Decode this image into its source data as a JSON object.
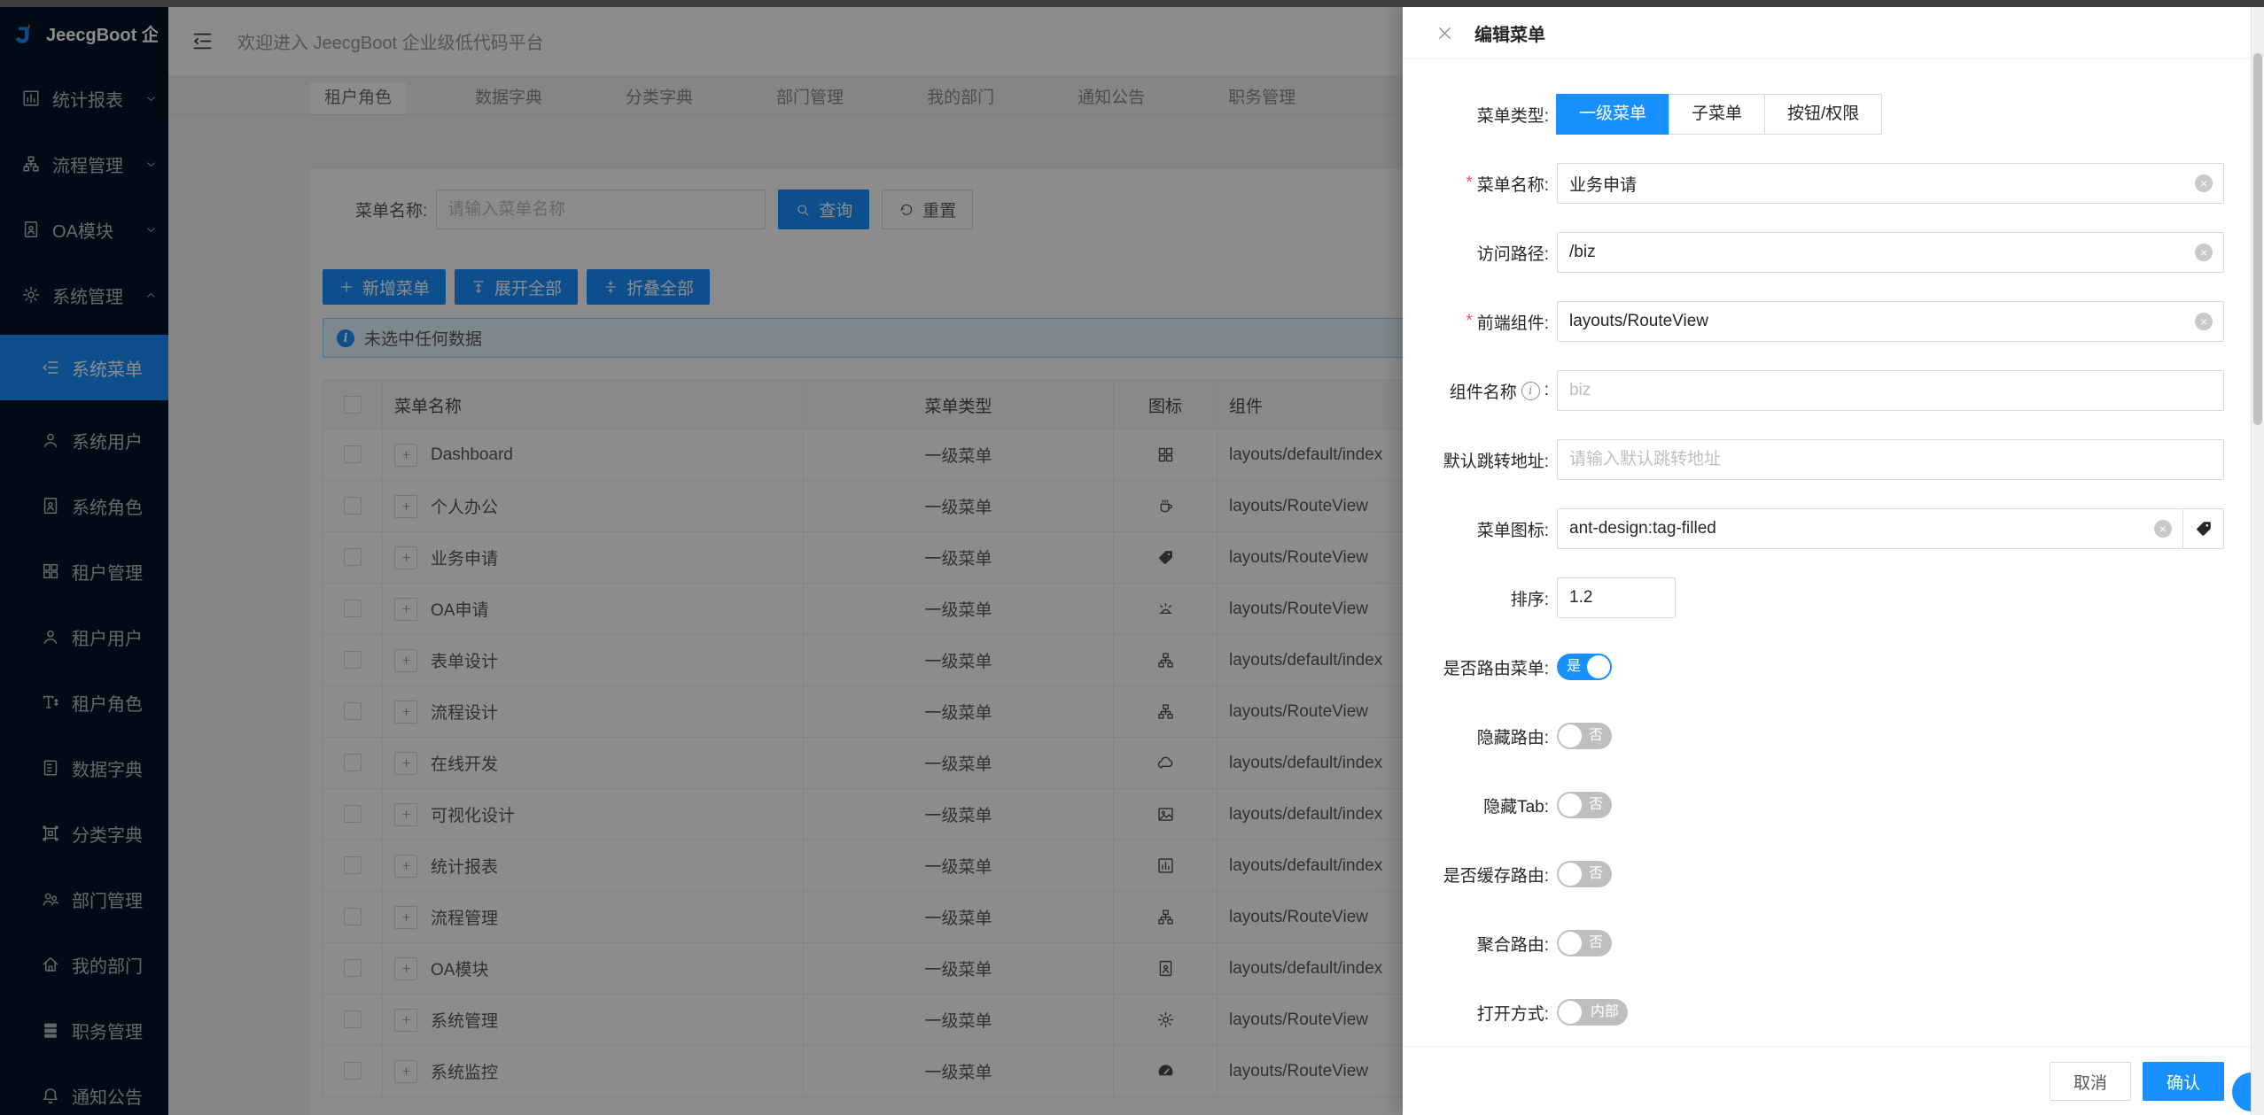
{
  "colors": {
    "accent": "#1890ff",
    "sidebar_bg": "#001529",
    "alert_bg": "#e6f7ff",
    "alert_border": "#91d5ff",
    "required": "#ff4d4f"
  },
  "sidebar": {
    "logo_text": "JeecgBoot 企业级...",
    "top_items": [
      {
        "icon": "bar-chart",
        "label": "统计报表",
        "chevron": "chevron-down"
      },
      {
        "icon": "cluster",
        "label": "流程管理",
        "chevron": "chevron-down"
      },
      {
        "icon": "file-user",
        "label": "OA模块",
        "chevron": "chevron-down"
      },
      {
        "icon": "gear",
        "label": "系统管理",
        "chevron": "chevron-up"
      }
    ],
    "submenu": [
      {
        "icon": "menu",
        "label": "系统菜单",
        "active": true
      },
      {
        "icon": "user",
        "label": "系统用户"
      },
      {
        "icon": "file-user",
        "label": "系统角色"
      },
      {
        "icon": "grid",
        "label": "租户管理"
      },
      {
        "icon": "user",
        "label": "租户用户"
      },
      {
        "icon": "font-size",
        "label": "租户角色"
      },
      {
        "icon": "database",
        "label": "数据字典"
      },
      {
        "icon": "box",
        "label": "分类字典"
      },
      {
        "icon": "team",
        "label": "部门管理"
      },
      {
        "icon": "home",
        "label": "我的部门"
      },
      {
        "icon": "stack",
        "label": "职务管理"
      },
      {
        "icon": "bell",
        "label": "通知公告"
      }
    ]
  },
  "header": {
    "welcome": "欢迎进入 JeecgBoot 企业级低代码平台"
  },
  "tabs": [
    {
      "label": "租户角色",
      "active": true
    },
    {
      "label": "数据字典"
    },
    {
      "label": "分类字典"
    },
    {
      "label": "部门管理"
    },
    {
      "label": "我的部门"
    },
    {
      "label": "通知公告"
    },
    {
      "label": "职务管理"
    }
  ],
  "search": {
    "label": "菜单名称:",
    "placeholder": "请输入菜单名称",
    "query": "查询",
    "reset": "重置"
  },
  "toolbar": {
    "add": "新增菜单",
    "expand": "展开全部",
    "collapse": "折叠全部"
  },
  "alert": {
    "text": "未选中任何数据"
  },
  "table": {
    "columns": [
      "菜单名称",
      "菜单类型",
      "图标",
      "组件"
    ],
    "rows": [
      {
        "name": "Dashboard",
        "type": "一级菜单",
        "icon": "grid",
        "component": "layouts/default/index"
      },
      {
        "name": "个人办公",
        "type": "一级菜单",
        "icon": "coffee",
        "component": "layouts/RouteView"
      },
      {
        "name": "业务申请",
        "type": "一级菜单",
        "icon": "tag-filled",
        "component": "layouts/RouteView"
      },
      {
        "name": "OA申请",
        "type": "一级菜单",
        "icon": "siren",
        "component": "layouts/RouteView"
      },
      {
        "name": "表单设计",
        "type": "一级菜单",
        "icon": "cluster",
        "component": "layouts/default/index"
      },
      {
        "name": "流程设计",
        "type": "一级菜单",
        "icon": "cluster",
        "component": "layouts/RouteView"
      },
      {
        "name": "在线开发",
        "type": "一级菜单",
        "icon": "cloud",
        "component": "layouts/default/index"
      },
      {
        "name": "可视化设计",
        "type": "一级菜单",
        "icon": "picture",
        "component": "layouts/default/index"
      },
      {
        "name": "统计报表",
        "type": "一级菜单",
        "icon": "bar-chart",
        "component": "layouts/default/index"
      },
      {
        "name": "流程管理",
        "type": "一级菜单",
        "icon": "cluster",
        "component": "layouts/RouteView"
      },
      {
        "name": "OA模块",
        "type": "一级菜单",
        "icon": "file-user",
        "component": "layouts/default/index"
      },
      {
        "name": "系统管理",
        "type": "一级菜单",
        "icon": "gear",
        "component": "layouts/RouteView"
      },
      {
        "name": "系统监控",
        "type": "一级菜单",
        "icon": "gauge",
        "component": "layouts/RouteView"
      }
    ]
  },
  "drawer": {
    "title": "编辑菜单",
    "menu_type": {
      "label": "菜单类型:",
      "options": [
        {
          "label": "一级菜单",
          "active": true
        },
        {
          "label": "子菜单"
        },
        {
          "label": "按钮/权限"
        }
      ]
    },
    "fields": [
      {
        "label": "菜单名称:",
        "required": true,
        "value": "业务申请"
      },
      {
        "label": "访问路径:",
        "value": "/biz"
      },
      {
        "label": "前端组件:",
        "required": true,
        "value": "layouts/RouteView"
      },
      {
        "label": "组件名称",
        "placeholder": "biz"
      },
      {
        "label": "默认跳转地址:",
        "placeholder": "请输入默认跳转地址"
      },
      {
        "label": "菜单图标:",
        "value": "ant-design:tag-filled"
      },
      {
        "label": "排序:",
        "value": "1.2"
      }
    ],
    "toggles": [
      {
        "label": "是否路由菜单:",
        "text": "是",
        "on": true
      },
      {
        "label": "隐藏路由:",
        "text": "否"
      },
      {
        "label": "隐藏Tab:",
        "text": "否"
      },
      {
        "label": "是否缓存路由:",
        "text": "否"
      },
      {
        "label": "聚合路由:",
        "text": "否"
      },
      {
        "label": "打开方式:",
        "text": "内部",
        "wide": true
      }
    ],
    "footer": {
      "cancel": "取消",
      "ok": "确认"
    }
  }
}
